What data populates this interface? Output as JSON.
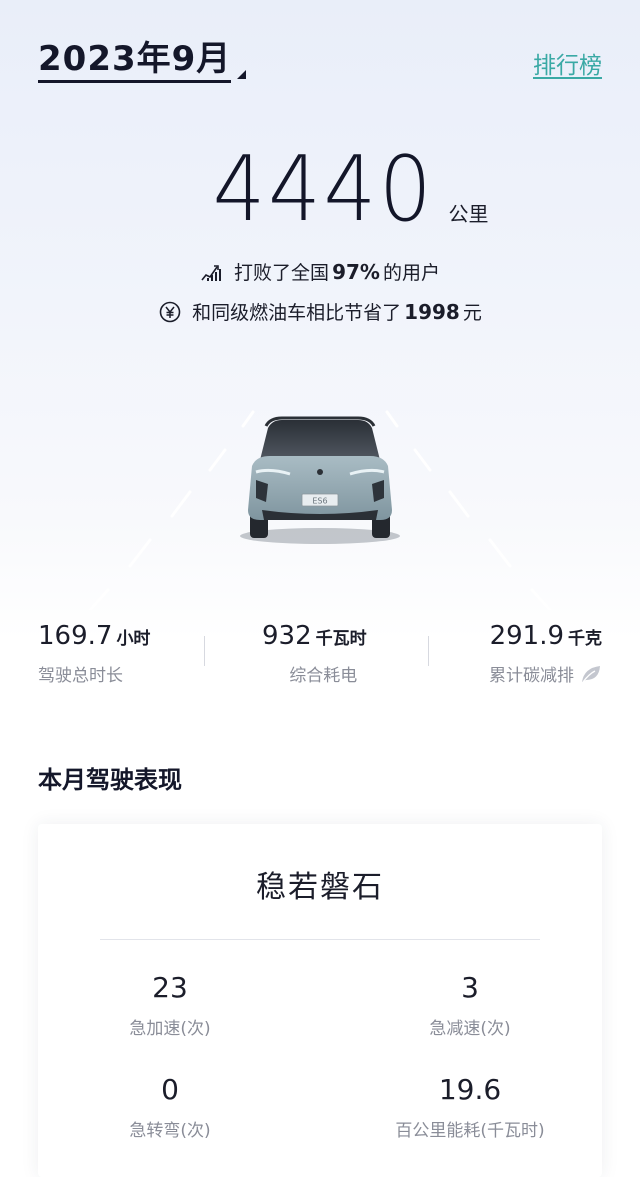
{
  "header": {
    "month": "2023年9月",
    "ranking_link": "排行榜"
  },
  "distance": {
    "value": "4440",
    "unit": "公里"
  },
  "beat": {
    "prefix": "打败了全国",
    "percent": "97%",
    "suffix": "的用户"
  },
  "saving": {
    "prefix": "和同级燃油车相比节省了",
    "amount": "1998",
    "suffix": "元"
  },
  "car": {
    "badge": "ES6"
  },
  "summary": [
    {
      "value": "169.7",
      "unit": "小时",
      "label": "驾驶总时长"
    },
    {
      "value": "932",
      "unit": "千瓦时",
      "label": "综合耗电"
    },
    {
      "value": "291.9",
      "unit": "千克",
      "label": "累计碳减排"
    }
  ],
  "section": {
    "title": "本月驾驶表现"
  },
  "performance": {
    "title": "稳若磐石",
    "metrics": [
      {
        "value": "23",
        "label": "急加速(次)"
      },
      {
        "value": "3",
        "label": "急减速(次)"
      },
      {
        "value": "0",
        "label": "急转弯(次)"
      },
      {
        "value": "19.6",
        "label": "百公里能耗(千瓦时)"
      }
    ]
  },
  "colors": {
    "accent": "#3aa9a5",
    "text": "#1b1d2a",
    "muted": "#8a8d98"
  }
}
